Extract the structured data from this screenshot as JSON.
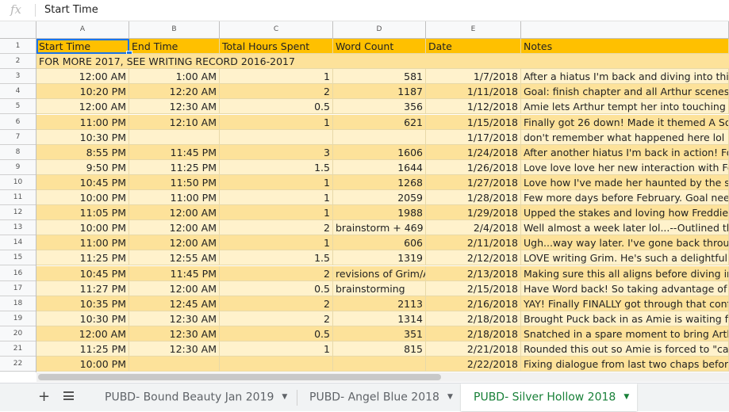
{
  "formula_bar": {
    "fx_label": "fx",
    "value": "Start Time"
  },
  "column_headers": [
    "A",
    "B",
    "C",
    "D",
    "E",
    ""
  ],
  "row_numbers": [
    "1",
    "2",
    "3",
    "4",
    "5",
    "6",
    "7",
    "8",
    "9",
    "10",
    "11",
    "12",
    "13",
    "14",
    "15",
    "16",
    "17",
    "18",
    "19",
    "20",
    "21",
    "22"
  ],
  "header_row": [
    "Start Time",
    "End Time",
    "Total Hours Spent",
    "Word Count",
    "Date",
    "Notes"
  ],
  "note_row": "FOR MORE 2017, SEE WRITING RECORD 2016-2017",
  "rows": [
    [
      "12:00 AM",
      "1:00 AM",
      "1",
      "581",
      "1/7/2018",
      "After a hiatus I'm back and diving into this as"
    ],
    [
      "10:20 PM",
      "12:20 AM",
      "2",
      "1187",
      "1/11/2018",
      "Goal: finish chapter and all Arthur scenes, se"
    ],
    [
      "12:00 AM",
      "12:30 AM",
      "0.5",
      "356",
      "1/12/2018",
      "Amie lets Arthur tempt her into touching Exc"
    ],
    [
      "11:00 PM",
      "12:10 AM",
      "1",
      "621",
      "1/15/2018",
      "Finally got 26 down! Made it themed A Song"
    ],
    [
      "10:30 PM",
      "",
      "",
      "",
      "1/17/2018",
      "don't remember what happened here lol"
    ],
    [
      "8:55 PM",
      "11:45 PM",
      "3",
      "1606",
      "1/24/2018",
      "After another hiatus I'm back in action! Forg"
    ],
    [
      "9:50 PM",
      "11:25 PM",
      "1.5",
      "1644",
      "1/26/2018",
      "Love love love her new interaction with Feat"
    ],
    [
      "10:45 PM",
      "11:50 PM",
      "1",
      "1268",
      "1/27/2018",
      "Love how I've made her haunted by the stud"
    ],
    [
      "10:00 PM",
      "11:00 PM",
      "1",
      "2059",
      "1/28/2018",
      "Few more days before February. Goal needs"
    ],
    [
      "11:05 PM",
      "12:00 AM",
      "1",
      "1988",
      "1/29/2018",
      "Upped the stakes and loving how Freddie jus"
    ],
    [
      "10:00 PM",
      "12:00 AM",
      "2",
      "brainstorm + 469 w",
      "2/4/2018",
      "Well almost a week later lol...--Outlined the r"
    ],
    [
      "11:00 PM",
      "12:00 AM",
      "1",
      "606",
      "2/11/2018",
      "Ugh...way way later. I've gone back through t"
    ],
    [
      "11:25 PM",
      "12:55 AM",
      "1.5",
      "1319",
      "2/12/2018",
      "LOVE writing Grim. He's such a delightfully w"
    ],
    [
      "10:45 PM",
      "11:45 PM",
      "2",
      "revisions of Grim/A",
      "2/13/2018",
      "Making sure this all aligns before diving into"
    ],
    [
      "11:27 PM",
      "12:00 AM",
      "0.5",
      "brainstorming",
      "2/15/2018",
      "Have Word back! So taking advantage of it :)"
    ],
    [
      "10:35 PM",
      "12:45 AM",
      "2",
      "2113",
      "2/16/2018",
      "YAY! Finally FINALLY got through that confro"
    ],
    [
      "10:30 PM",
      "12:30 AM",
      "2",
      "1314",
      "2/18/2018",
      "Brought Puck back in as Amie is waiting for A"
    ],
    [
      "12:00 AM",
      "12:30 AM",
      "0.5",
      "351",
      "2/18/2018",
      "Snatched in a spare moment to bring Arthur"
    ],
    [
      "11:25 PM",
      "12:30 AM",
      "1",
      "815",
      "2/21/2018",
      "Rounded this out so Amie is forced to \"call\" t"
    ],
    [
      "10:00 PM",
      "",
      "",
      "",
      "2/22/2018",
      "Fixing dialogue from last two chaps before p"
    ]
  ],
  "tabs": [
    {
      "label": "PUBD- Bound Beauty Jan 2019",
      "active": false
    },
    {
      "label": "PUBD- Angel Blue 2018",
      "active": false
    },
    {
      "label": "PUBD- Silver Hollow 2018",
      "active": true
    }
  ],
  "icons": {
    "add_sheet": "plus-icon",
    "all_sheets": "menu-icon",
    "tab_caret": "caret-down-icon"
  },
  "colors": {
    "header_fill": "#ffc000",
    "band_dark": "#fde29a",
    "band_light": "#fff2cc",
    "active_tab_text": "#188038",
    "selection": "#1a73e8"
  }
}
